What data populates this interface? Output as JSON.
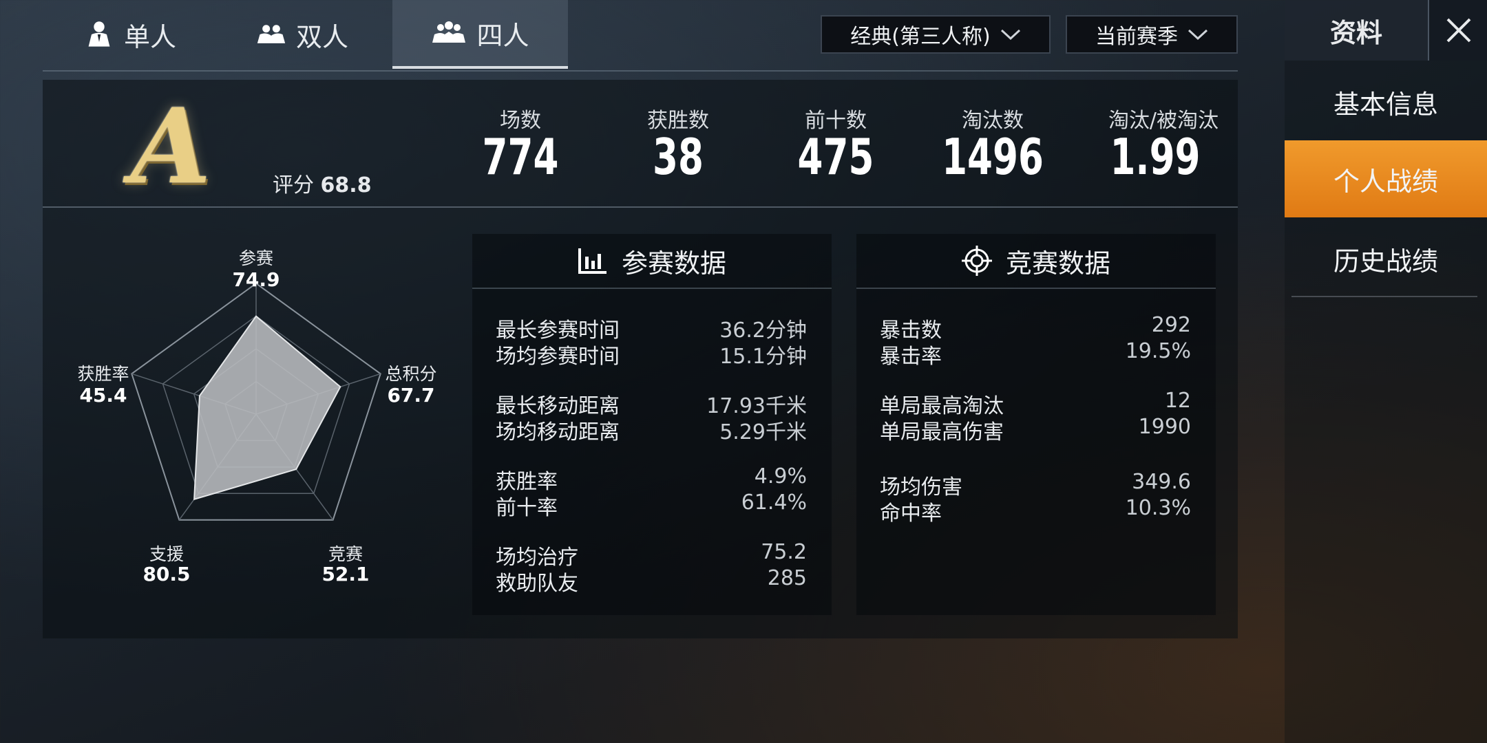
{
  "tabs": [
    {
      "label": "单人",
      "icon": "single-person-icon"
    },
    {
      "label": "双人",
      "icon": "duo-icon"
    },
    {
      "label": "四人",
      "icon": "squad-icon",
      "active": true
    }
  ],
  "filters": {
    "mode": "经典(第三人称)",
    "season": "当前赛季"
  },
  "sidebar": {
    "title": "资料",
    "items": [
      {
        "label": "基本信息"
      },
      {
        "label": "个人战绩",
        "active": true
      },
      {
        "label": "历史战绩"
      }
    ]
  },
  "summary": {
    "grade": "A",
    "score_label": "评分",
    "score_value": "68.8",
    "stats": [
      {
        "label": "场数",
        "value": "774"
      },
      {
        "label": "获胜数",
        "value": "38"
      },
      {
        "label": "前十数",
        "value": "475"
      },
      {
        "label": "淘汰数",
        "value": "1496"
      },
      {
        "label": "淘汰/被淘汰",
        "value": "1.99"
      }
    ]
  },
  "radar": {
    "axes": [
      {
        "name": "参赛",
        "value": 74.9
      },
      {
        "name": "总积分",
        "value": 67.7
      },
      {
        "name": "竞赛",
        "value": 52.1
      },
      {
        "name": "支援",
        "value": 80.5
      },
      {
        "name": "获胜率",
        "value": 45.4
      }
    ],
    "max": 100,
    "fill_color": "#b9bcbf"
  },
  "participation": {
    "title": "参赛数据",
    "groups": [
      [
        {
          "label": "最长参赛时间",
          "value": "36.2分钟"
        },
        {
          "label": "场均参赛时间",
          "value": "15.1分钟"
        }
      ],
      [
        {
          "label": "最长移动距离",
          "value": "17.93千米"
        },
        {
          "label": "场均移动距离",
          "value": "5.29千米"
        }
      ],
      [
        {
          "label": "获胜率",
          "value": "4.9%"
        },
        {
          "label": "前十率",
          "value": "61.4%"
        }
      ],
      [
        {
          "label": "场均治疗",
          "value": "75.2"
        },
        {
          "label": "救助队友",
          "value": "285"
        }
      ]
    ]
  },
  "combat": {
    "title": "竞赛数据",
    "groups": [
      [
        {
          "label": "暴击数",
          "value": "292"
        },
        {
          "label": "暴击率",
          "value": "19.5%"
        }
      ],
      [
        {
          "label": "单局最高淘汰",
          "value": "12"
        },
        {
          "label": "单局最高伤害",
          "value": "1990"
        }
      ],
      [
        {
          "label": "场均伤害",
          "value": "349.6"
        },
        {
          "label": "命中率",
          "value": "10.3%"
        }
      ]
    ]
  },
  "colors": {
    "accent_orange": "#e8861c",
    "grade_gold": "#e9cf86"
  }
}
